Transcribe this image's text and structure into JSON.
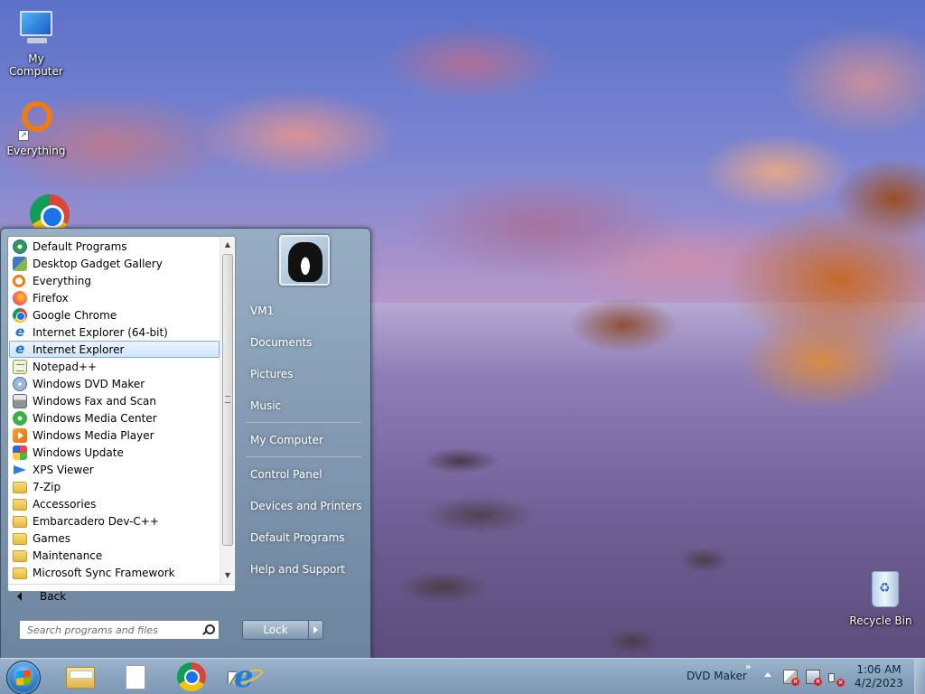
{
  "desktop": {
    "icons": [
      {
        "label": "My Computer",
        "icon": "computer-icon"
      },
      {
        "label": "Everything",
        "icon": "everything-icon"
      },
      {
        "label": "",
        "icon": "chrome-icon"
      },
      {
        "label": "Recycle Bin",
        "icon": "recycle-bin-icon"
      }
    ]
  },
  "start_menu": {
    "programs": [
      {
        "label": "Default Programs",
        "icon": "default-programs-icon"
      },
      {
        "label": "Desktop Gadget Gallery",
        "icon": "gadget-gallery-icon"
      },
      {
        "label": "Everything",
        "icon": "everything-icon"
      },
      {
        "label": "Firefox",
        "icon": "firefox-icon"
      },
      {
        "label": "Google Chrome",
        "icon": "chrome-icon"
      },
      {
        "label": "Internet Explorer (64-bit)",
        "icon": "ie-icon"
      },
      {
        "label": "Internet Explorer",
        "icon": "ie-icon",
        "selected": true
      },
      {
        "label": "Notepad++",
        "icon": "notepad-plus-icon"
      },
      {
        "label": "Windows DVD Maker",
        "icon": "dvd-maker-icon"
      },
      {
        "label": "Windows Fax and Scan",
        "icon": "fax-scan-icon"
      },
      {
        "label": "Windows Media Center",
        "icon": "media-center-icon"
      },
      {
        "label": "Windows Media Player",
        "icon": "media-player-icon"
      },
      {
        "label": "Windows Update",
        "icon": "windows-update-icon"
      },
      {
        "label": "XPS Viewer",
        "icon": "xps-viewer-icon"
      },
      {
        "label": "7-Zip",
        "icon": "folder-icon"
      },
      {
        "label": "Accessories",
        "icon": "folder-icon"
      },
      {
        "label": "Embarcadero Dev-C++",
        "icon": "folder-icon"
      },
      {
        "label": "Games",
        "icon": "folder-icon"
      },
      {
        "label": "Maintenance",
        "icon": "folder-icon"
      },
      {
        "label": "Microsoft Sync Framework",
        "icon": "folder-icon"
      }
    ],
    "back_label": "Back",
    "search_placeholder": "Search programs and files",
    "right_items": [
      "VM1",
      "Documents",
      "Pictures",
      "Music",
      "My Computer",
      "Control Panel",
      "Devices and Printers",
      "Default Programs",
      "Help and Support"
    ],
    "lock_label": "Lock"
  },
  "taskbar": {
    "pinned": [
      "explorer-icon",
      "blank-document-icon",
      "chrome-icon",
      "ie-icon"
    ],
    "tray_label": "DVD Maker",
    "time": "1:06 AM",
    "date": "4/2/2023"
  }
}
